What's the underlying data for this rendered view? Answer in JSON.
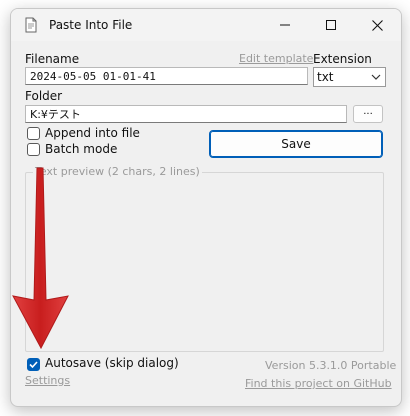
{
  "window": {
    "title": "Paste Into File"
  },
  "titlebar_icons": {
    "app": "document-icon",
    "minimize": "minimize-icon",
    "maximize": "maximize-icon",
    "close": "close-icon"
  },
  "form": {
    "filename_label": "Filename",
    "filename_value": "2024-05-05 01-01-41",
    "edit_template_label": "Edit template",
    "extension_label": "Extension",
    "extension_value": "txt",
    "folder_label": "Folder",
    "folder_value": "K:¥テスト",
    "browse_label": "...",
    "append_label": "Append into file",
    "append_checked": false,
    "batch_label": "Batch mode",
    "batch_checked": false,
    "save_label": "Save",
    "preview_label": "Text preview (2 chars, 2 lines)",
    "autosave_label": "Autosave (skip dialog)",
    "autosave_checked": true,
    "settings_label": "Settings",
    "version_label": "Version 5.3.1.0 Portable",
    "github_label": "Find this project on GitHub"
  },
  "colors": {
    "accent": "#005fb8",
    "arrow": "#d42b2b",
    "disabled_text": "#9a9a9a"
  },
  "overlay": {
    "arrow_icon": "red-down-arrow"
  }
}
